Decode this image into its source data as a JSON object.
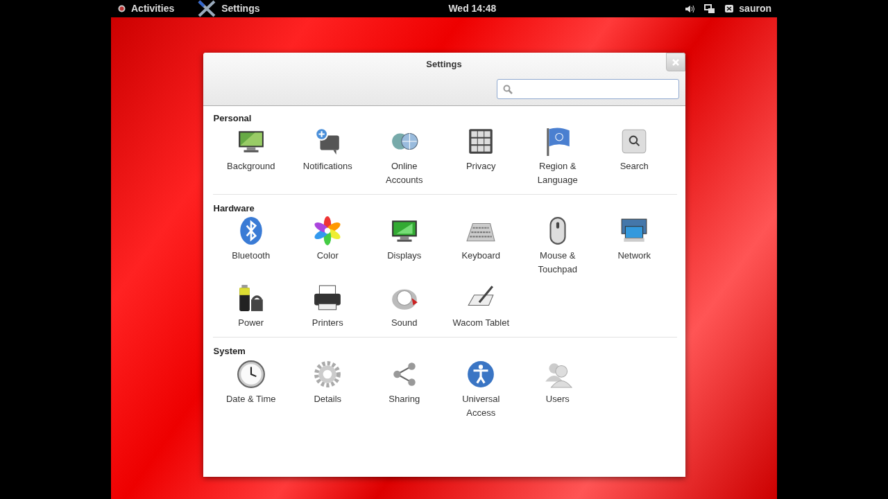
{
  "top_bar": {
    "activities": "Activities",
    "app_name": "Settings",
    "clock": "Wed 14:48",
    "user": "sauron"
  },
  "window": {
    "title": "Settings"
  },
  "sections": [
    {
      "title": "Personal",
      "items": [
        {
          "label": "Background"
        },
        {
          "label": "Notifications"
        },
        {
          "label": "Online Accounts"
        },
        {
          "label": "Privacy"
        },
        {
          "label": "Region & Language"
        },
        {
          "label": "Search"
        }
      ]
    },
    {
      "title": "Hardware",
      "items": [
        {
          "label": "Bluetooth"
        },
        {
          "label": "Color"
        },
        {
          "label": "Displays"
        },
        {
          "label": "Keyboard"
        },
        {
          "label": "Mouse & Touchpad"
        },
        {
          "label": "Network"
        },
        {
          "label": "Power"
        },
        {
          "label": "Printers"
        },
        {
          "label": "Sound"
        },
        {
          "label": "Wacom Tablet"
        }
      ]
    },
    {
      "title": "System",
      "items": [
        {
          "label": "Date & Time"
        },
        {
          "label": "Details"
        },
        {
          "label": "Sharing"
        },
        {
          "label": "Universal Access"
        },
        {
          "label": "Users"
        }
      ]
    }
  ]
}
